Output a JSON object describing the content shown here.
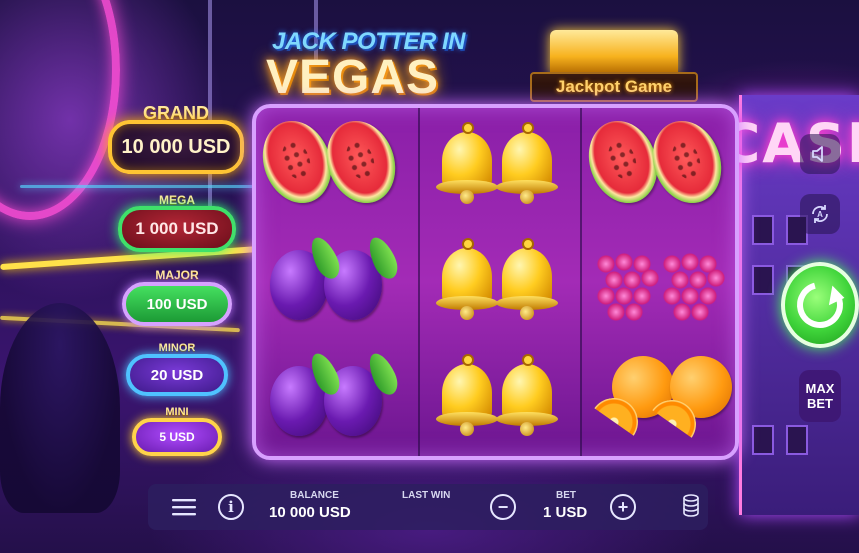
{
  "game": {
    "title_line1": "JACK POTTER IN",
    "title_line2": "VEGAS",
    "jackpot_game_label": "Jackpot Game",
    "background_sign": "CASI"
  },
  "jackpots": [
    {
      "tier": "GRAND",
      "amount": "10 000 USD"
    },
    {
      "tier": "MEGA",
      "amount": "1 000 USD"
    },
    {
      "tier": "MAJOR",
      "amount": "100 USD"
    },
    {
      "tier": "MINOR",
      "amount": "20 USD"
    },
    {
      "tier": "MINI",
      "amount": "5 USD"
    }
  ],
  "reels": [
    [
      "watermelon",
      "plum",
      "plum"
    ],
    [
      "bell",
      "bell",
      "bell"
    ],
    [
      "watermelon",
      "grapes",
      "orange"
    ]
  ],
  "controls": {
    "max_bet_line1": "MAX",
    "max_bet_line2": "BET",
    "spin_icon": "refresh-icon",
    "sound_icon": "speaker-icon",
    "autoplay_icon": "autoplay-icon"
  },
  "bottom_bar": {
    "balance_label": "BALANCE",
    "balance_value": "10 000 USD",
    "last_win_label": "LAST WIN",
    "last_win_value": "",
    "bet_label": "BET",
    "bet_value": "1 USD",
    "minus_symbol": "−",
    "plus_symbol": "+",
    "info_symbol": "i"
  },
  "colors": {
    "grand_border": "#ffc433",
    "mega_border": "#3fe06a",
    "major_fill": "#45e060",
    "minor_border": "#4fc2ff",
    "mini_border": "#ffd34a",
    "spin_green": "#3fd43a",
    "reel_frame": "#d8a0ff"
  }
}
